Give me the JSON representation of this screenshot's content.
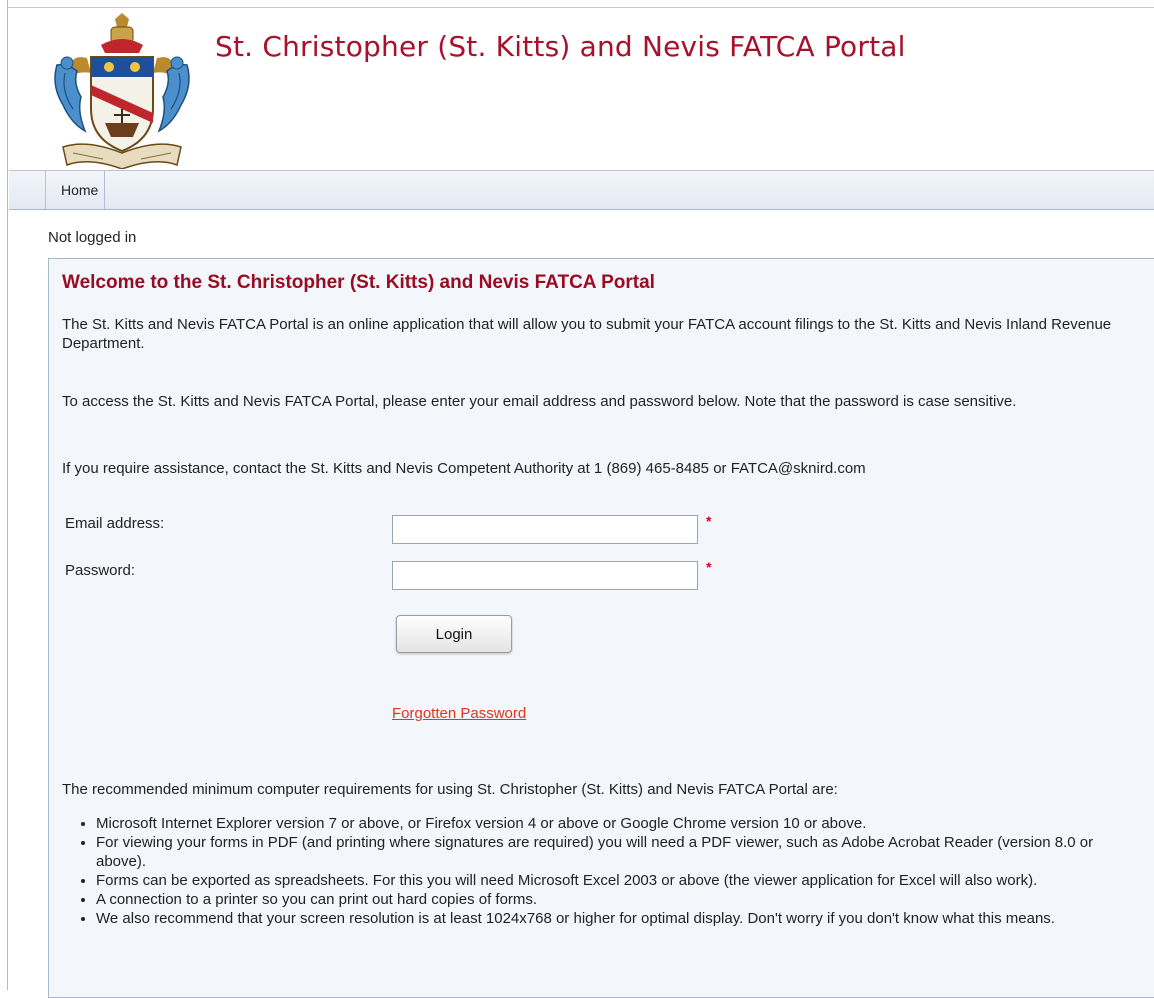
{
  "header": {
    "title": "St. Christopher (St. Kitts) and Nevis FATCA Portal",
    "crest_icon": "coat-of-arms"
  },
  "nav": {
    "items": [
      {
        "label": "Home"
      }
    ]
  },
  "status": "Not logged in",
  "welcome": {
    "heading": "Welcome to the St. Christopher (St. Kitts) and Nevis FATCA Portal",
    "paragraphs": [
      "The St. Kitts and Nevis FATCA Portal is an online application that will allow you to submit your FATCA account filings to the St. Kitts and Nevis Inland Revenue Department.",
      "To access the St. Kitts and Nevis FATCA Portal, please enter your email address and password below. Note that the password is case sensitive.",
      "If you require assistance, contact the St. Kitts and Nevis Competent Authority at 1 (869) 465-8485 or FATCA@sknird.com"
    ]
  },
  "form": {
    "email_label": "Email address:",
    "email_value": "",
    "password_label": "Password:",
    "password_value": "",
    "required_marker": "*",
    "login_label": "Login",
    "forgot_label": "Forgotten Password"
  },
  "requirements": {
    "intro": "The recommended minimum computer requirements for using St. Christopher (St. Kitts) and Nevis FATCA Portal are:",
    "items": [
      "Microsoft Internet Explorer version 7 or above, or Firefox version 4 or above or Google Chrome version 10 or above.",
      "For viewing your forms in PDF (and printing where signatures are required) you will need a PDF viewer, such as Adobe Acrobat Reader (version 8.0 or above).",
      "Forms can be exported as spreadsheets. For this you will need Microsoft Excel 2003 or above (the viewer application for Excel will also work).",
      "A connection to a printer so you can print out hard copies of forms.",
      "We also recommend that your screen resolution is at least 1024x768 or higher for optimal display. Don't worry if you don't know what this means."
    ]
  },
  "colors": {
    "title_red": "#a8102b",
    "heading_red": "#9b0b22",
    "link_red": "#e3341b",
    "panel_bg": "#f3f7fc",
    "nav_bg": "#e3e9f3"
  }
}
